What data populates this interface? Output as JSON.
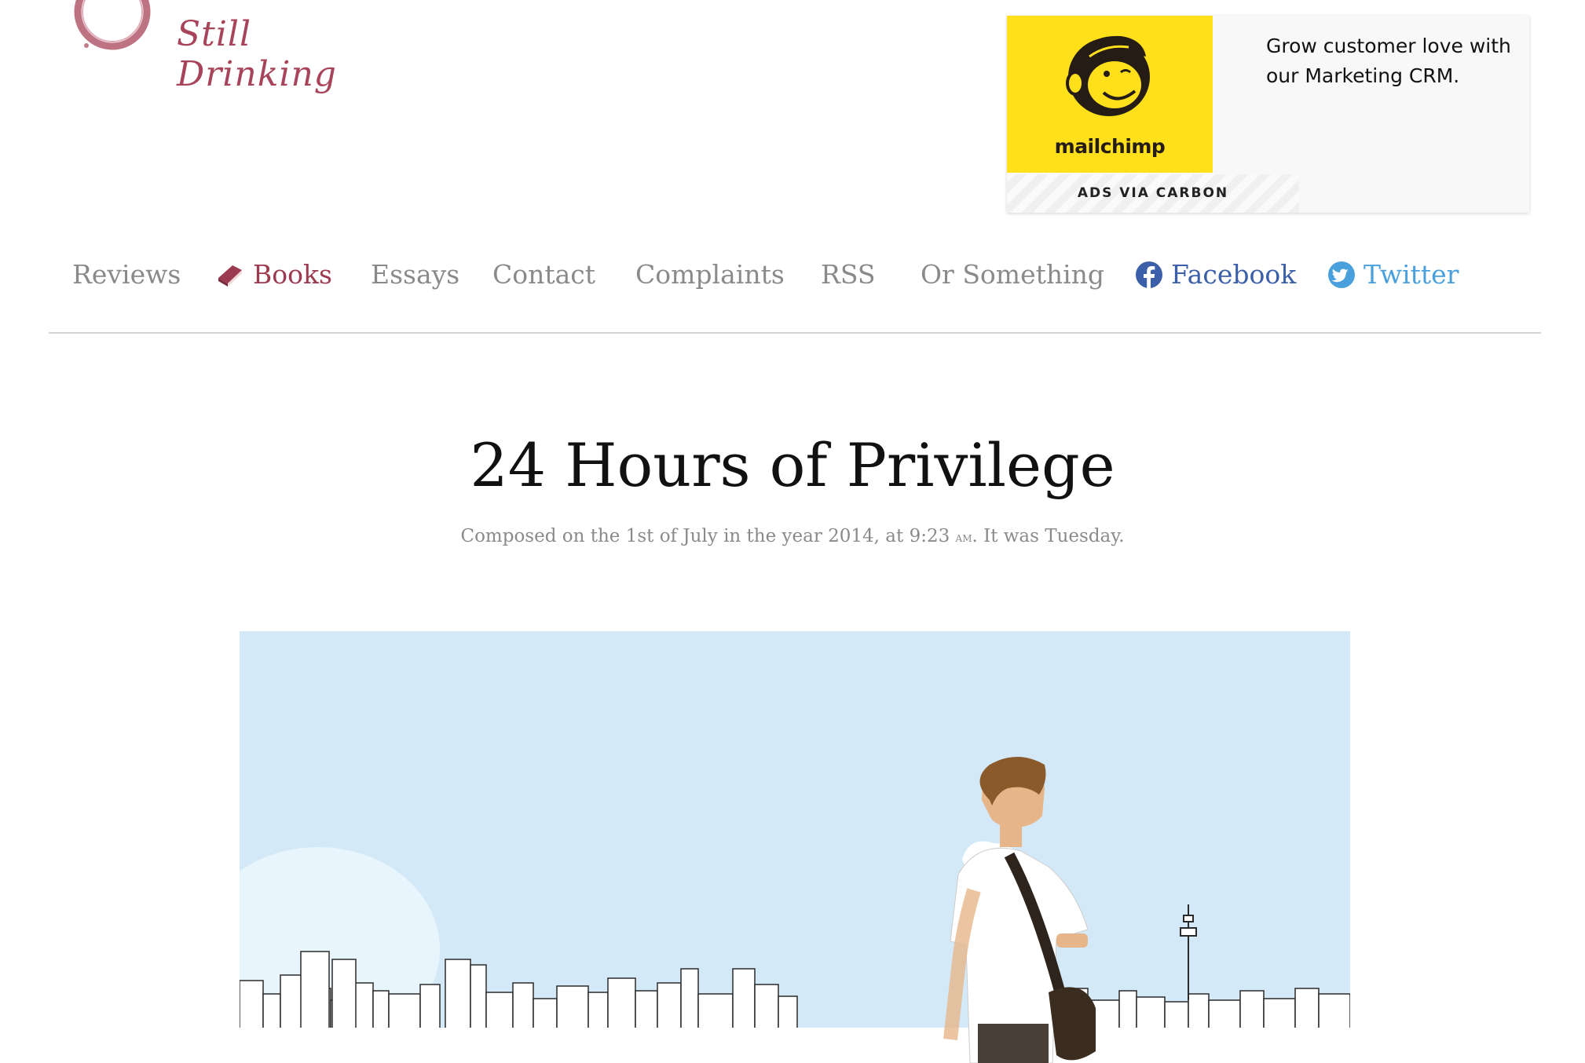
{
  "site": {
    "logo_text": "Still Drinking"
  },
  "ad": {
    "brand": "mailchimp",
    "text": "Grow customer love with our Marketing CRM.",
    "via": "ADS VIA CARBON"
  },
  "nav": {
    "items": [
      {
        "label": "Reviews"
      },
      {
        "label": "Books",
        "icon": "book-icon"
      },
      {
        "label": "Essays"
      },
      {
        "label": "Contact"
      },
      {
        "label": "Complaints"
      },
      {
        "label": "RSS"
      },
      {
        "label": "Or Something"
      },
      {
        "label": "Facebook",
        "icon": "facebook-icon"
      },
      {
        "label": "Twitter",
        "icon": "twitter-icon"
      }
    ]
  },
  "article": {
    "title": "24 Hours of Privilege",
    "date_prefix": "Composed on the 1st of July in the year 2014, at 9:23",
    "date_ampm": "am",
    "date_suffix": ". It was Tuesday."
  },
  "colors": {
    "accent": "#9c3a4f",
    "facebook": "#3b5fa8",
    "twitter": "#4aa0dc",
    "ad_yellow": "#ffe01b",
    "hero_sky": "#d4e9f7"
  }
}
